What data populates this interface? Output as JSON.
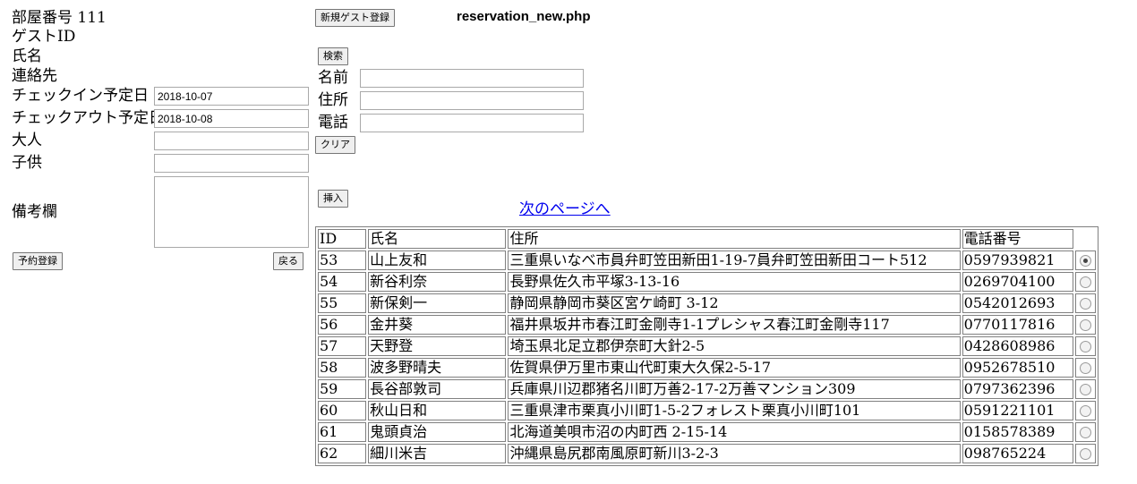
{
  "left": {
    "room_label": "部屋番号 111",
    "guest_id_label": "ゲストID",
    "name_label": "氏名",
    "contact_label": "連絡先",
    "checkin_label": "チェックイン予定日",
    "checkin_value": "2018-10-07",
    "checkout_label": "チェックアウト予定日",
    "checkout_value": "2018-10-08",
    "adult_label": "大人",
    "child_label": "子供",
    "notes_label": "備考欄",
    "reserve_button": "予約登録",
    "back_button": "戻る"
  },
  "header": {
    "new_guest_button": "新規ゲスト登録",
    "page_title": "reservation_new.php"
  },
  "search": {
    "search_button": "検索",
    "name_label": "名前",
    "address_label": "住所",
    "phone_label": "電話",
    "clear_button": "クリア",
    "insert_button": "挿入",
    "next_page_link": "次のページへ"
  },
  "table": {
    "headers": [
      "ID",
      "氏名",
      "住所",
      "電話番号"
    ],
    "rows": [
      {
        "id": "53",
        "name": "山上友和",
        "address": "三重県いなべ市員弁町笠田新田1-19-7員弁町笠田新田コート512",
        "phone": "0597939821",
        "selected": true
      },
      {
        "id": "54",
        "name": "新谷利奈",
        "address": "長野県佐久市平塚3-13-16",
        "phone": "0269704100",
        "selected": false
      },
      {
        "id": "55",
        "name": "新保剣一",
        "address": "静岡県静岡市葵区宮ケ崎町 3-12",
        "phone": "0542012693",
        "selected": false
      },
      {
        "id": "56",
        "name": "金井葵",
        "address": "福井県坂井市春江町金剛寺1-1プレシャス春江町金剛寺117",
        "phone": "0770117816",
        "selected": false
      },
      {
        "id": "57",
        "name": "天野登",
        "address": "埼玉県北足立郡伊奈町大針2-5",
        "phone": "0428608986",
        "selected": false
      },
      {
        "id": "58",
        "name": "波多野晴夫",
        "address": "佐賀県伊万里市東山代町東大久保2-5-17",
        "phone": "0952678510",
        "selected": false
      },
      {
        "id": "59",
        "name": "長谷部敦司",
        "address": "兵庫県川辺郡猪名川町万善2-17-2万善マンション309",
        "phone": "0797362396",
        "selected": false
      },
      {
        "id": "60",
        "name": "秋山日和",
        "address": "三重県津市栗真小川町1-5-2フォレスト栗真小川町101",
        "phone": "0591221101",
        "selected": false
      },
      {
        "id": "61",
        "name": "鬼頭貞治",
        "address": "北海道美唄市沼の内町西 2-15-14",
        "phone": "0158578389",
        "selected": false
      },
      {
        "id": "62",
        "name": "細川米吉",
        "address": "沖縄県島尻郡南風原町新川3-2-3",
        "phone": "098765224",
        "selected": false
      }
    ]
  }
}
